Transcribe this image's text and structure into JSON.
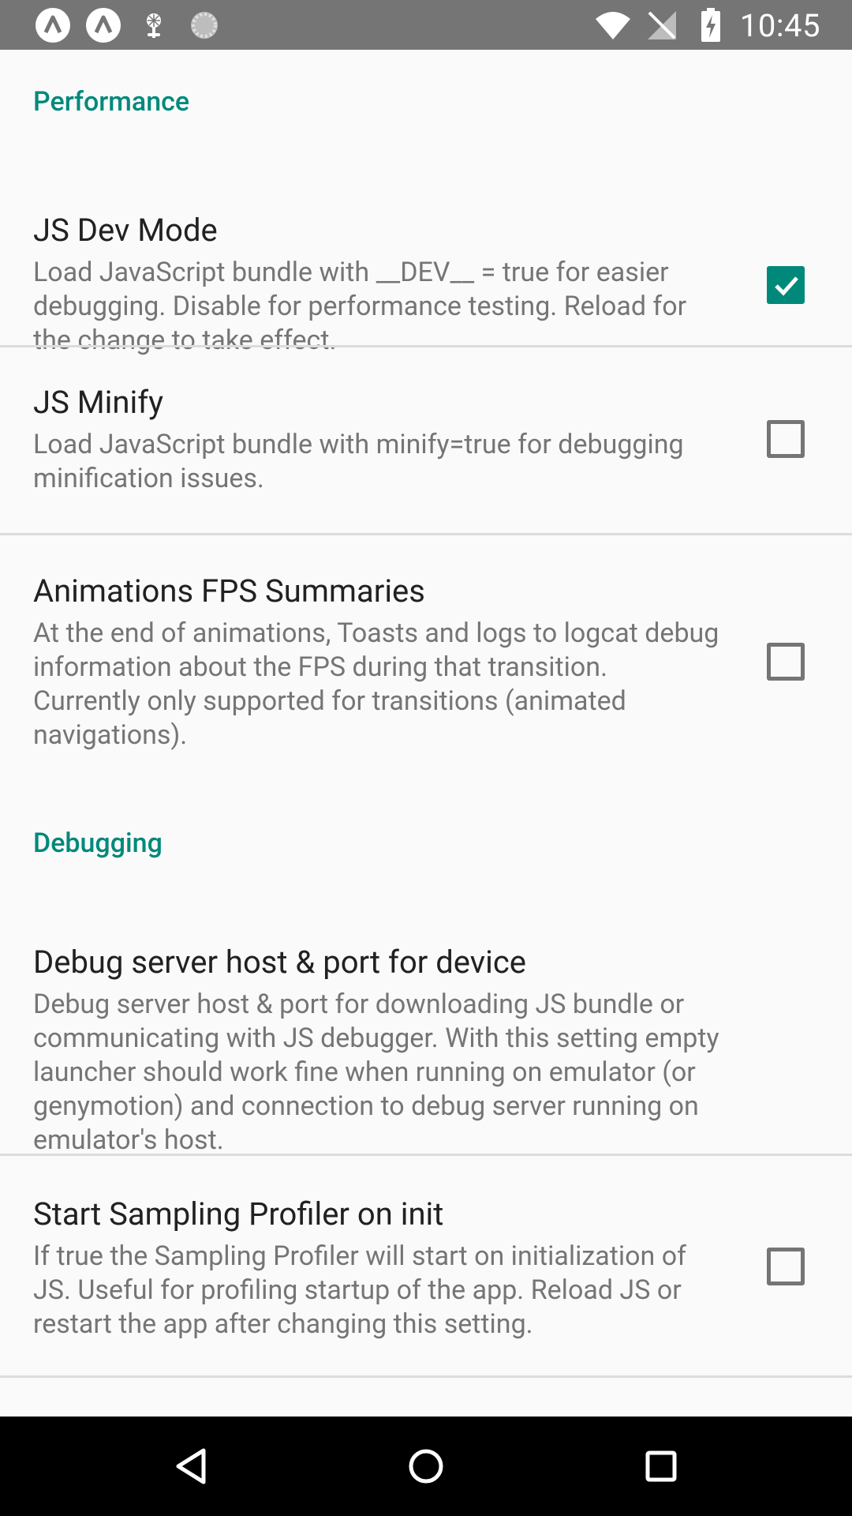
{
  "status_bar": {
    "time": "10:45",
    "left_icons": [
      "notification-a-icon",
      "notification-a-icon",
      "settings-app-icon",
      "loading-spinner-icon"
    ],
    "right_icons": [
      "wifi-icon",
      "no-signal-icon",
      "battery-charging-icon"
    ]
  },
  "sections": [
    {
      "title": "Performance",
      "prefs": [
        {
          "title": "JS Dev Mode",
          "summary": "Load JavaScript bundle with __DEV__ = true for easier debugging. Disable for performance testing. Reload for the change to take effect.",
          "checked": true
        },
        {
          "title": "JS Minify",
          "summary": "Load JavaScript bundle with minify=true for debugging minification issues.",
          "checked": false
        },
        {
          "title": "Animations FPS Summaries",
          "summary": "At the end of animations, Toasts and logs to logcat debug information about the FPS during that transition. Currently only supported for transitions (animated navigations).",
          "checked": false
        }
      ]
    },
    {
      "title": "Debugging",
      "prefs": [
        {
          "title": "Debug server host & port for device",
          "summary": "Debug server host & port for downloading JS bundle or communicating with JS debugger. With this setting empty launcher should work fine when running on emulator (or genymotion) and connection to debug server running on emulator's host."
        },
        {
          "title": "Start Sampling Profiler on init",
          "summary": "If true the Sampling Profiler will start on initialization of JS. Useful for profiling startup of the app. Reload JS or restart the app after changing this setting.",
          "checked": false
        }
      ]
    }
  ],
  "nav_bar": {
    "buttons": [
      "back-icon",
      "home-icon",
      "recents-icon"
    ]
  },
  "colors": {
    "accent": "#00897b",
    "status_bar": "#757575",
    "background": "#fafafa"
  }
}
